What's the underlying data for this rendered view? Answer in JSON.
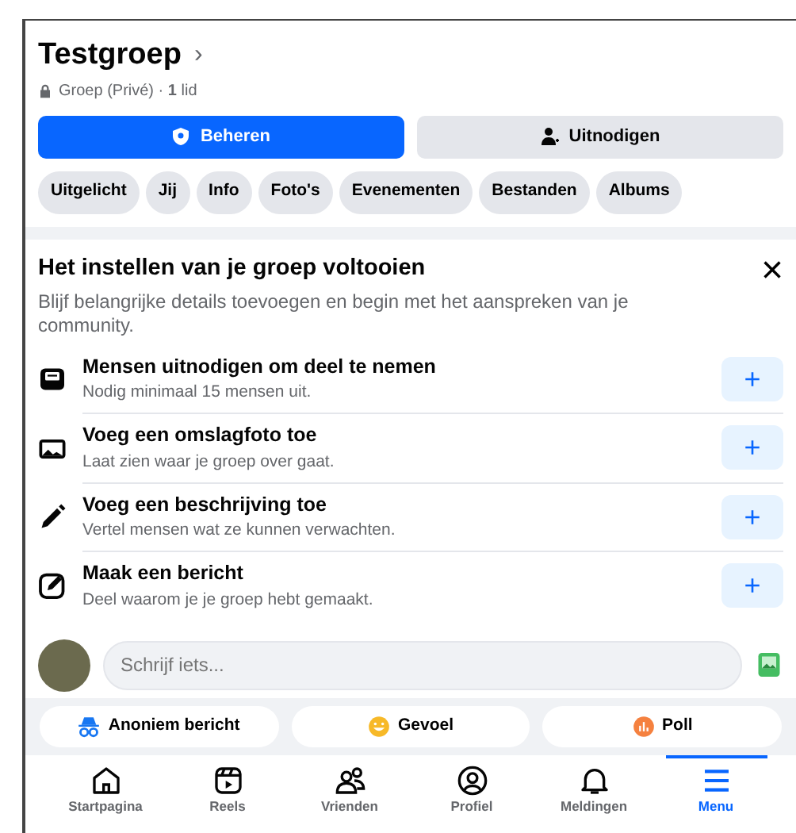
{
  "group": {
    "name": "Testgroep",
    "chevron": "›",
    "privacy": "Groep (Privé) · **1** lid"
  },
  "actions": [
    {
      "kind": "manage",
      "label": "Beheren",
      "primary": true
    },
    {
      "kind": "invite",
      "label": "Uitnodigen",
      "primary": false
    }
  ],
  "chips": [
    "Uitgelicht",
    "Jij",
    "Info",
    "Foto's",
    "Evenementen",
    "Bestanden",
    "Albums"
  ],
  "setup": {
    "title": "Het instellen van je groep voltooien",
    "close": "×",
    "subtitle": "Blijf belangrijke details toevoegen en begin met het aanspreken van je community.",
    "tasks": [
      {
        "kind": "invite",
        "title": "Mensen uitnodigen om deel te nemen",
        "detail": "Nodig minimaal 15 mensen uit.",
        "button": "+"
      },
      {
        "kind": "cover",
        "title": "Voeg een omslagfoto toe",
        "detail": "Laat zien waar je groep over gaat.",
        "button": "+"
      },
      {
        "kind": "description",
        "title": "Voeg een beschrijving toe",
        "detail": "Vertel mensen wat ze kunnen verwachten.",
        "button": "+"
      },
      {
        "kind": "post",
        "title": "Maak een bericht",
        "detail": "Deel waarom je je groep hebt gemaakt.",
        "button": "+"
      }
    ]
  },
  "composer": {
    "placeholder": "Schrijf iets..."
  },
  "post_options": [
    {
      "kind": "anonymous",
      "label": "Anoniem bericht"
    },
    {
      "kind": "feeling",
      "label": "Gevoel"
    },
    {
      "kind": "poll",
      "label": "Poll"
    }
  ],
  "bottom_nav": [
    {
      "kind": "home",
      "label": "Startpagina",
      "selected": false
    },
    {
      "kind": "reels",
      "label": "Reels",
      "selected": false
    },
    {
      "kind": "friends",
      "label": "Vrienden",
      "selected": false
    },
    {
      "kind": "profile",
      "label": "Profiel",
      "selected": false
    },
    {
      "kind": "bell",
      "label": "Meldingen",
      "selected": false
    },
    {
      "kind": "menu",
      "label": "Menu",
      "selected": true
    }
  ]
}
